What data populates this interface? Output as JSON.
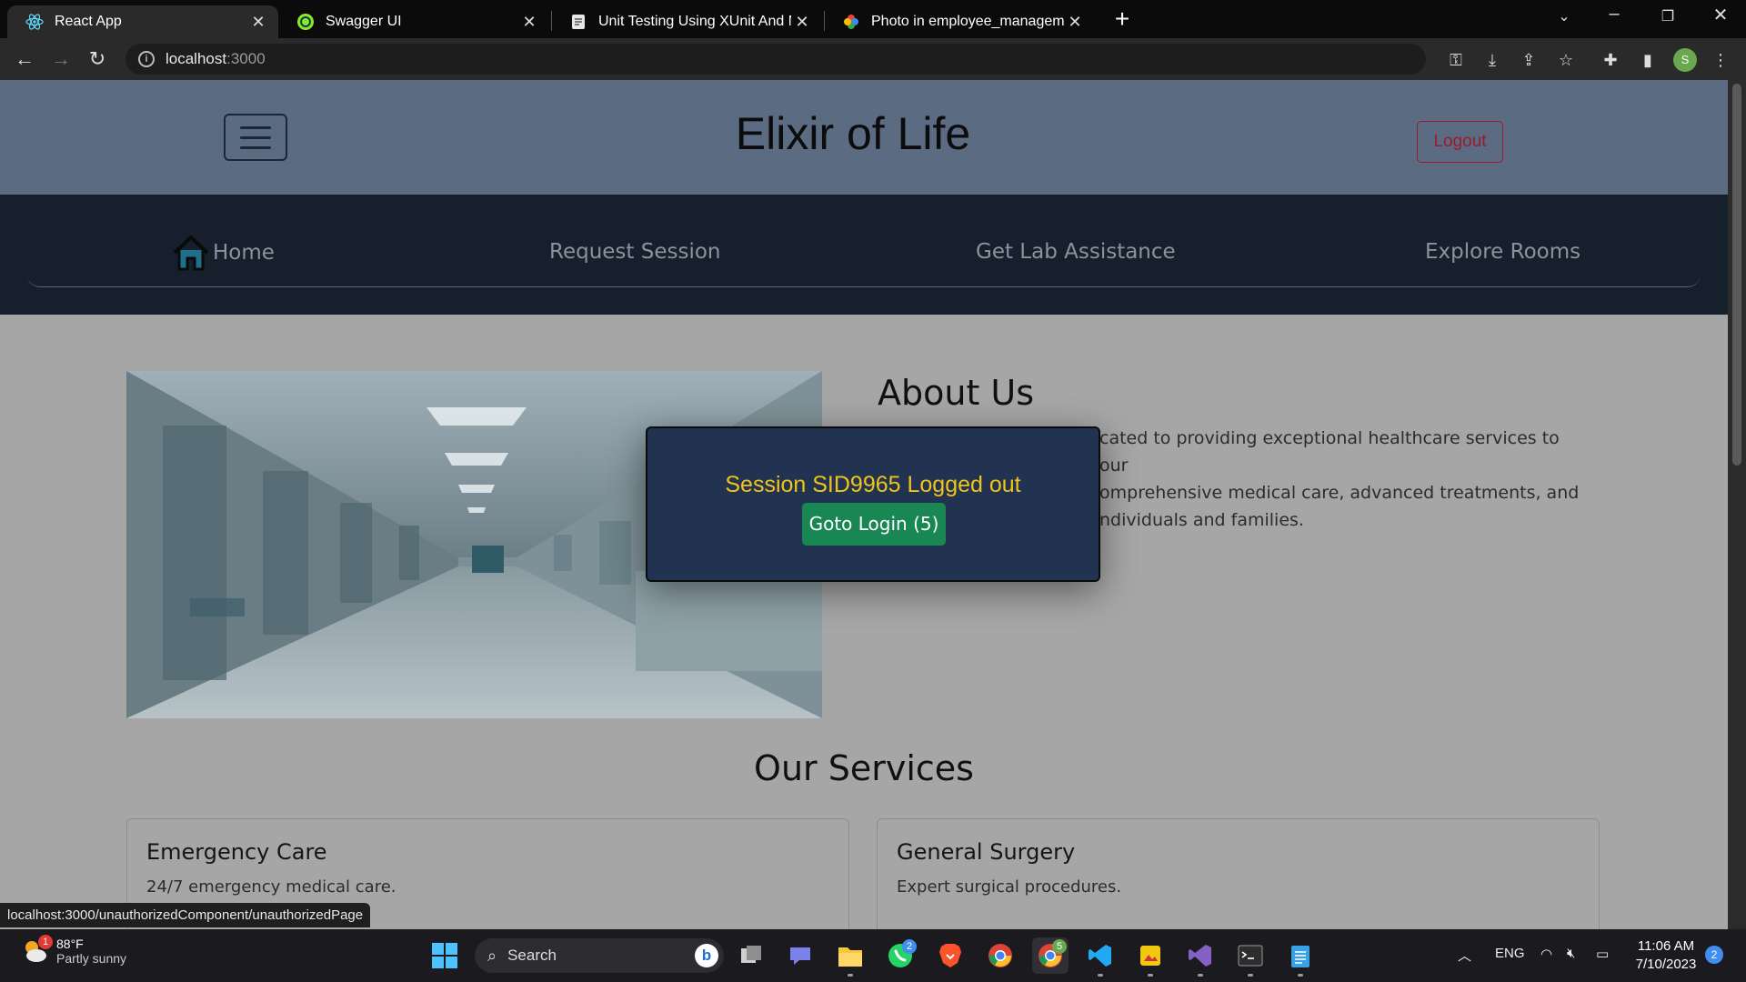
{
  "browser": {
    "tabs": [
      {
        "title": "React App",
        "icon": "react-icon",
        "active": true
      },
      {
        "title": "Swagger UI",
        "icon": "swagger-icon",
        "active": false
      },
      {
        "title": "Unit Testing Using XUnit And MC",
        "icon": "article-icon",
        "active": false
      },
      {
        "title": "Photo in employee_management",
        "icon": "photos-icon",
        "active": false
      }
    ],
    "url_host": "localhost",
    "url_port": ":3000",
    "profile_initial": "S"
  },
  "site": {
    "title": "Elixir of Life",
    "logout_label": "Logout",
    "nav": {
      "home": "Home",
      "request_session": "Request Session",
      "lab_assistance": "Get Lab Assistance",
      "explore_rooms": "Explore Rooms"
    },
    "about": {
      "title": "About Us",
      "lines": [
        "cated to providing exceptional healthcare services to our",
        "omprehensive medical care, advanced treatments, and",
        "ndividuals and families."
      ]
    },
    "services": {
      "title": "Our Services",
      "cards": [
        {
          "title": "Emergency Care",
          "desc": "24/7 emergency medical care."
        },
        {
          "title": "General Surgery",
          "desc": "Expert surgical procedures."
        }
      ]
    }
  },
  "modal": {
    "message": "Session SID9965 Logged out",
    "button_label": "Goto Login (5)"
  },
  "status_link": "localhost:3000/unauthorizedComponent/unauthorizedPage",
  "taskbar": {
    "weather_temp": "88°F",
    "weather_cond": "Partly sunny",
    "weather_badge": "1",
    "search_label": "Search",
    "whatsapp_badge": "2",
    "chrome_badge": "5",
    "lang": "ENG",
    "time": "11:06 AM",
    "date": "7/10/2023",
    "notifications": "2"
  },
  "colors": {
    "header_bg": "#5a6b82",
    "nav_bg": "#15202c",
    "modal_bg": "#223352",
    "modal_text": "#f0c419",
    "modal_button": "#198754",
    "logout": "#9b1b2e"
  }
}
